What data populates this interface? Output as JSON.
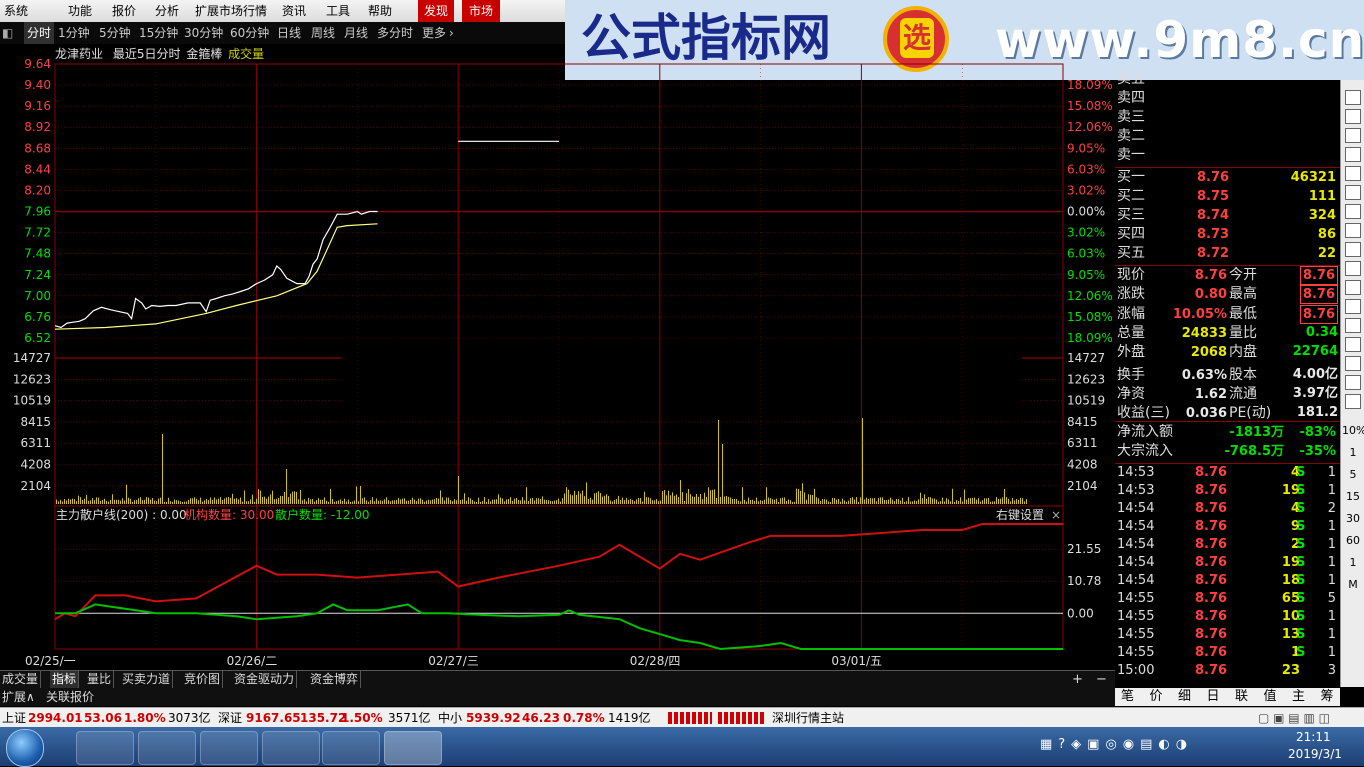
{
  "menu": {
    "items": [
      "系统",
      "功能",
      "报价",
      "分析",
      "扩展市场行情",
      "资讯",
      "工具",
      "帮助"
    ],
    "discover": "发现",
    "market": "市场"
  },
  "banner": {
    "title": "公式指标网",
    "url": "www.9m8.cn",
    "logo_char": "选"
  },
  "timeframes": [
    "分时",
    "1分钟",
    "5分钟",
    "15分钟",
    "30分钟",
    "60分钟",
    "日线",
    "周线",
    "月线",
    "多分时",
    "更多"
  ],
  "chart_title": {
    "stock": "龙津药业",
    "period": "最近5日分时",
    "indicator": "金箍棒",
    "vol": "成交量"
  },
  "colors": {
    "up": "#ff4040",
    "down": "#00e000",
    "grid": "#8b0000",
    "price": "#ffffff",
    "avg": "#ffff80",
    "volume": "#d4c400"
  },
  "chart_data": [
    {
      "type": "line",
      "name": "intraday",
      "title": "",
      "ylim": [
        6.52,
        9.64
      ],
      "y_ticks_left": [
        "9.64",
        "9.40",
        "9.16",
        "8.92",
        "8.68",
        "8.44",
        "8.20",
        "7.96",
        "7.72",
        "7.48",
        "7.24",
        "7.00",
        "6.76",
        "6.52"
      ],
      "y_ticks_right": [
        "18.09%",
        "15.08%",
        "12.06%",
        "9.05%",
        "6.03%",
        "3.02%",
        "0.00%",
        "3.02%",
        "6.03%",
        "9.05%",
        "12.06%",
        "15.08%",
        "18.09%"
      ],
      "series": [
        {
          "points": [
            [
              0,
              6.66
            ],
            [
              0.03,
              6.64
            ],
            [
              0.06,
              6.69
            ],
            [
              0.09,
              6.7
            ],
            [
              0.12,
              6.71
            ],
            [
              0.15,
              6.74
            ],
            [
              0.19,
              6.83
            ],
            [
              0.23,
              6.87
            ],
            [
              0.28,
              6.84
            ],
            [
              0.32,
              6.82
            ],
            [
              0.36,
              6.8
            ],
            [
              0.38,
              6.74
            ],
            [
              0.4,
              6.97
            ],
            [
              0.43,
              6.92
            ],
            [
              0.45,
              6.85
            ],
            [
              0.48,
              6.89
            ],
            [
              0.52,
              6.88
            ],
            [
              0.56,
              6.89
            ],
            [
              0.6,
              6.89
            ],
            [
              0.66,
              6.92
            ],
            [
              0.72,
              6.92
            ],
            [
              0.75,
              6.82
            ],
            [
              0.77,
              6.95
            ],
            [
              0.8,
              6.97
            ],
            [
              0.84,
              7.0
            ],
            [
              0.88,
              7.02
            ],
            [
              0.92,
              7.05
            ],
            [
              0.96,
              7.08
            ],
            [
              1.0,
              7.14
            ],
            [
              1.04,
              7.18
            ],
            [
              1.08,
              7.24
            ],
            [
              1.1,
              7.34
            ],
            [
              1.12,
              7.3
            ],
            [
              1.15,
              7.2
            ],
            [
              1.2,
              7.14
            ],
            [
              1.24,
              7.14
            ],
            [
              1.26,
              7.22
            ],
            [
              1.28,
              7.36
            ],
            [
              1.3,
              7.42
            ],
            [
              1.33,
              7.64
            ],
            [
              1.36,
              7.76
            ],
            [
              1.4,
              7.93
            ],
            [
              1.45,
              7.93
            ],
            [
              1.5,
              7.96
            ],
            [
              1.52,
              7.93
            ],
            [
              1.56,
              7.96
            ],
            [
              1.6,
              7.96
            ]
          ]
        },
        {
          "points": [
            [
              0,
              6.62
            ],
            [
              0.25,
              6.64
            ],
            [
              0.5,
              6.68
            ],
            [
              0.75,
              6.8
            ],
            [
              0.9,
              6.89
            ],
            [
              1.1,
              7.0
            ],
            [
              1.25,
              7.14
            ],
            [
              1.3,
              7.28
            ],
            [
              1.36,
              7.58
            ],
            [
              1.4,
              7.78
            ],
            [
              1.45,
              7.8
            ],
            [
              1.6,
              7.82
            ]
          ]
        },
        {
          "points": [
            [
              2.0,
              8.76
            ],
            [
              2.5,
              8.76
            ]
          ]
        }
      ]
    },
    {
      "type": "bar",
      "name": "volume",
      "ylim": [
        0,
        14727
      ],
      "y_ticks": [
        "14727",
        "12623",
        "10519",
        "8415",
        "6311",
        "4208",
        "2104"
      ]
    },
    {
      "type": "line",
      "name": "主力散户线",
      "title": "主力散户线(200)",
      "ylim": [
        -12,
        30
      ],
      "y_ticks": [
        "21.55",
        "10.78",
        "0.00"
      ],
      "x_labels": [
        "02/25/一",
        "02/26/二",
        "02/27/三",
        "02/28/四",
        "03/01/五"
      ],
      "labels": {
        "main": "主力散户线(200) : 0.00",
        "inst": "机构数量: 30.00",
        "retail": "散户数量: -12.00",
        "settings": "右键设置"
      }
    }
  ],
  "order_book": {
    "sell": [
      "卖五",
      "卖四",
      "卖三",
      "卖二",
      "卖一"
    ],
    "buy": [
      {
        "label": "买一",
        "price": "8.76",
        "vol": "46321"
      },
      {
        "label": "买二",
        "price": "8.75",
        "vol": "111"
      },
      {
        "label": "买三",
        "price": "8.74",
        "vol": "324"
      },
      {
        "label": "买四",
        "price": "8.73",
        "vol": "86"
      },
      {
        "label": "买五",
        "price": "8.72",
        "vol": "22"
      }
    ]
  },
  "quote": [
    {
      "a": "现价",
      "av": "8.76",
      "b": "今开",
      "bv": "8.76"
    },
    {
      "a": "涨跌",
      "av": "0.80",
      "b": "最高",
      "bv": "8.76"
    },
    {
      "a": "涨幅",
      "av": "10.05%",
      "b": "最低",
      "bv": "8.76"
    },
    {
      "a": "总量",
      "av": "24833",
      "b": "量比",
      "bv": "0.34"
    },
    {
      "a": "外盘",
      "av": "2068",
      "b": "内盘",
      "bv": "22764"
    },
    {
      "a": "换手",
      "av": "0.63%",
      "b": "股本",
      "bv": "4.00亿"
    },
    {
      "a": "净资",
      "av": "1.62",
      "b": "流通",
      "bv": "3.97亿"
    },
    {
      "a": "收益(三)",
      "av": "0.036",
      "b": "PE(动)",
      "bv": "181.2"
    }
  ],
  "flow": [
    {
      "label": "净流入额",
      "v1": "-1813万",
      "v2": "-83%"
    },
    {
      "label": "大宗流入",
      "v1": "-768.5万",
      "v2": "-35%"
    }
  ],
  "ticks": [
    {
      "t": "14:53",
      "p": "8.76",
      "v": "4",
      "s": "S",
      "n": "1"
    },
    {
      "t": "14:53",
      "p": "8.76",
      "v": "19",
      "s": "S",
      "n": "1"
    },
    {
      "t": "14:54",
      "p": "8.76",
      "v": "4",
      "s": "S",
      "n": "2"
    },
    {
      "t": "14:54",
      "p": "8.76",
      "v": "9",
      "s": "S",
      "n": "1"
    },
    {
      "t": "14:54",
      "p": "8.76",
      "v": "2",
      "s": "S",
      "n": "1"
    },
    {
      "t": "14:54",
      "p": "8.76",
      "v": "19",
      "s": "S",
      "n": "1"
    },
    {
      "t": "14:54",
      "p": "8.76",
      "v": "18",
      "s": "S",
      "n": "1"
    },
    {
      "t": "14:55",
      "p": "8.76",
      "v": "65",
      "s": "S",
      "n": "5"
    },
    {
      "t": "14:55",
      "p": "8.76",
      "v": "10",
      "s": "S",
      "n": "1"
    },
    {
      "t": "14:55",
      "p": "8.76",
      "v": "13",
      "s": "S",
      "n": "1"
    },
    {
      "t": "14:55",
      "p": "8.76",
      "v": "1",
      "s": "S",
      "n": "1"
    },
    {
      "t": "15:00",
      "p": "8.76",
      "v": "23",
      "s": "",
      "n": "3"
    }
  ],
  "right_toolbar": [
    "10%",
    "1",
    "5",
    "15",
    "30",
    "60",
    "1",
    "M"
  ],
  "bottom_tabs": [
    "成交量",
    "指标",
    "量比",
    "买卖力道",
    "竞价图",
    "资金驱动力",
    "资金博弈"
  ],
  "bottom_tab_controls": [
    "+",
    "−"
  ],
  "ext_tabs": [
    "扩展∧",
    "关联报价"
  ],
  "right_tabs": [
    "笔",
    "价",
    "细",
    "日",
    "联",
    "值",
    "主",
    "筹"
  ],
  "status": {
    "sh": {
      "label": "上证",
      "v": "2994.01",
      "c": "53.06",
      "p": "1.80%",
      "amt": "3073亿"
    },
    "sz": {
      "label": "深证",
      "v": "9167.65",
      "c": "135.72",
      "p": "1.50%",
      "amt": "3571亿"
    },
    "zx": {
      "label": "中小",
      "v": "5939.92",
      "c": "46.23",
      "p": "0.78%",
      "amt": "1419亿"
    },
    "server": "深圳行情主站"
  },
  "taskbar": {
    "time": "21:11",
    "date": "2019/3/1"
  }
}
